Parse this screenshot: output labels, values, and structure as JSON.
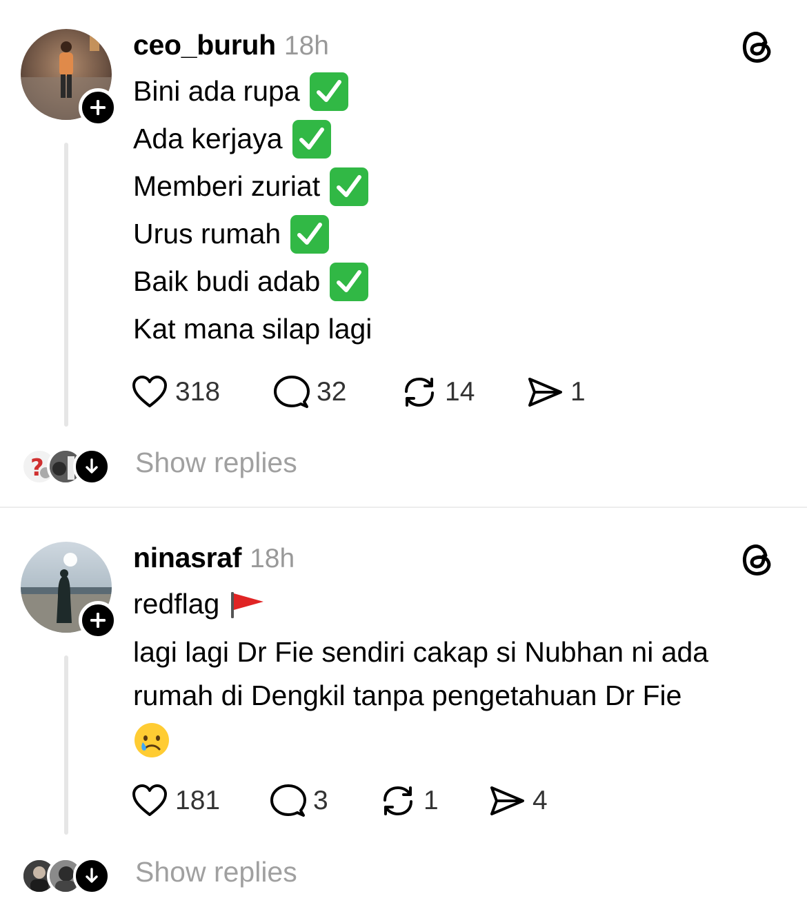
{
  "posts": [
    {
      "username": "ceo_buruh",
      "time": "18h",
      "lines": [
        "Bini ada rupa",
        "Ada kerjaya",
        "Memberi zuriat",
        "Urus rumah",
        "Baik budi adab",
        "Kat mana silap lagi"
      ],
      "checked_lines": 5,
      "likes": "318",
      "comments": "32",
      "reposts": "14",
      "shares": "1",
      "show_replies": "Show replies"
    },
    {
      "username": "ninasraf",
      "time": "18h",
      "line1": "redflag",
      "line1_emoji": "red-flag-icon",
      "body": "lagi lagi Dr Fie sendiri cakap si Nubhan ni ada rumah di Dengkil tanpa pengetahuan Dr Fie",
      "body_emoji": "crying-face-icon",
      "likes": "181",
      "comments": "3",
      "reposts": "1",
      "shares": "4",
      "show_replies": "Show replies"
    }
  ],
  "colors": {
    "check": "#31b845",
    "muted": "#999999",
    "line": "#e6e6e6"
  }
}
